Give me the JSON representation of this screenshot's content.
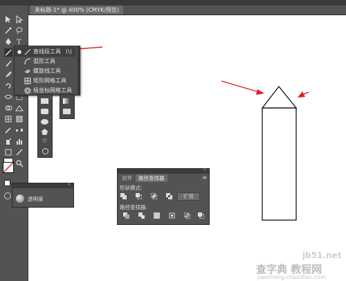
{
  "document_tab": {
    "title": "未标题-1* @ 400% (CMYK/预览)"
  },
  "tools": [
    "selection-icon",
    "direct-selection-icon",
    "magic-wand-icon",
    "lasso-icon",
    "pen-icon",
    "type-icon",
    "line-segment-icon",
    "rectangle-icon",
    "paintbrush-icon",
    "pencil-icon",
    "blob-brush-icon",
    "eraser-icon",
    "rotate-icon",
    "scale-icon",
    "width-icon",
    "free-transform-icon",
    "shape-builder-icon",
    "perspective-grid-icon",
    "mesh-icon",
    "gradient-icon",
    "eyedropper-icon",
    "blend-icon",
    "symbol-sprayer-icon",
    "column-graph-icon",
    "artboard-icon",
    "slice-icon",
    "hand-icon",
    "zoom-icon"
  ],
  "flyout": {
    "items": [
      {
        "label": "直线段工具",
        "shortcut": "(\\)"
      },
      {
        "label": "弧形工具"
      },
      {
        "label": "螺旋线工具"
      },
      {
        "label": "矩形网格工具"
      },
      {
        "label": "极坐标网格工具"
      }
    ]
  },
  "transparency_panel": {
    "label": "透明度"
  },
  "pathfinder_panel": {
    "tabs": [
      "对齐",
      "路径查找器"
    ],
    "shape_modes_label": "形状模式:",
    "pathfinders_label": "路径查找器:",
    "expand_label": "扩展"
  },
  "watermark": {
    "site": "jb51.net",
    "brand": "查字典 教程网",
    "url": "jiaocheng.chazidian.com"
  },
  "colors": {
    "annotation_arrow": "#e02020",
    "ui_dark": "#535353",
    "canvas": "#ffffff"
  }
}
